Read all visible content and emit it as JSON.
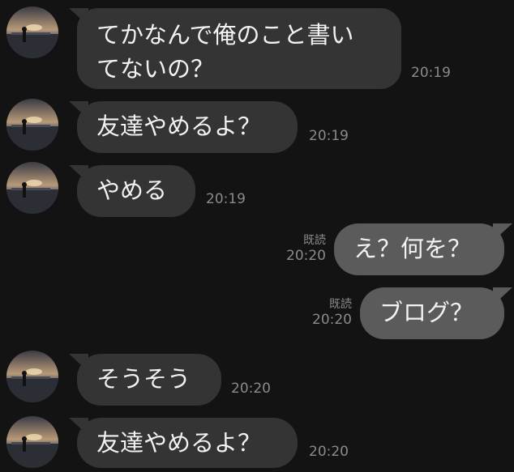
{
  "messages": [
    {
      "direction": "in",
      "text_lines": [
        "てかなんで俺のこと書い",
        "てないの？"
      ],
      "time": "20:19"
    },
    {
      "direction": "in",
      "text_lines": [
        "友達やめるよ？"
      ],
      "time": "20:19"
    },
    {
      "direction": "in",
      "text_lines": [
        "やめる"
      ],
      "time": "20:19"
    },
    {
      "direction": "out",
      "text_lines": [
        "え？何を？"
      ],
      "read_label": "既読",
      "time": "20:20"
    },
    {
      "direction": "out",
      "text_lines": [
        "ブログ？"
      ],
      "read_label": "既読",
      "time": "20:20"
    },
    {
      "direction": "in",
      "text_lines": [
        "そうそう"
      ],
      "time": "20:20"
    },
    {
      "direction": "in",
      "text_lines": [
        "友達やめるよ？"
      ],
      "time": "20:20"
    }
  ],
  "colors": {
    "background": "#131313",
    "incoming_bubble": "#343434",
    "outgoing_bubble": "#5b5b5b",
    "text": "#f2f2f2",
    "meta": "#8a8a8a"
  },
  "avatar_icon": "sunset-beach-person-photo"
}
